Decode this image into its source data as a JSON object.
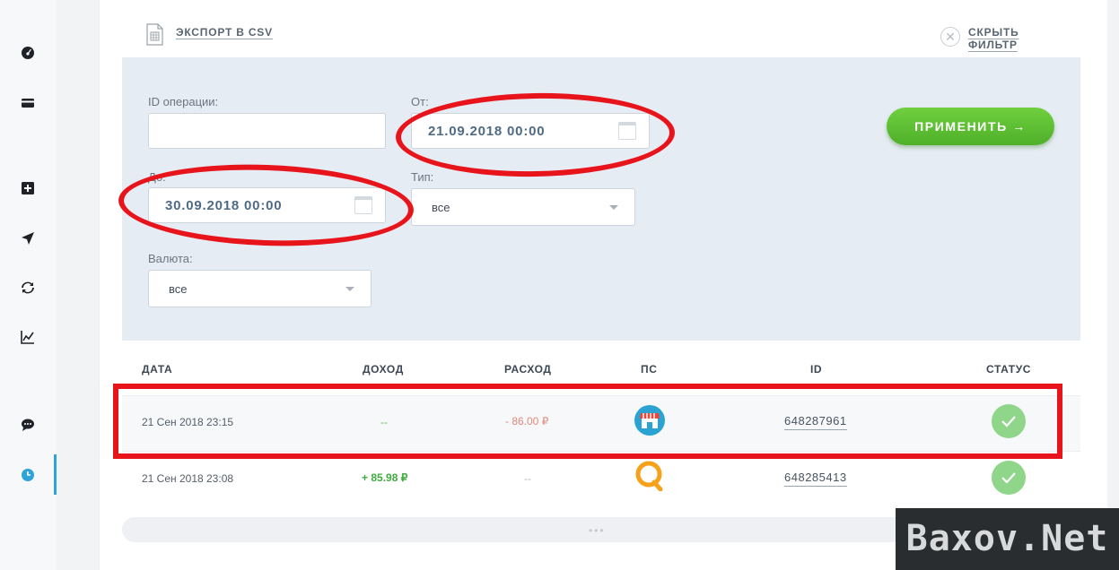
{
  "toolbar": {
    "export_label": "ЭКСПОРТ В CSV",
    "hide_filter_label": "СКРЫТЬ ФИЛЬТР"
  },
  "filter": {
    "op_id_label": "ID операции:",
    "op_id_value": "",
    "from_label": "От:",
    "from_value": "21.09.2018 00:00",
    "to_label": "До:",
    "to_value": "30.09.2018 00:00",
    "type_label": "Тип:",
    "type_value": "все",
    "currency_label": "Валюта:",
    "currency_value": "все",
    "apply_label": "ПРИМЕНИТЬ →"
  },
  "table": {
    "headers": [
      "ДАТА",
      "ДОХОД",
      "РАСХОД",
      "ПС",
      "ID",
      "СТАТУС"
    ],
    "rows": [
      {
        "date": "21 Сен 2018 23:15",
        "income": "--",
        "expense": "- 86.00 ₽",
        "ps": "shop-icon",
        "id": "648287961",
        "status": "check-icon"
      },
      {
        "date": "21 Сен 2018 23:08",
        "income": "+ 85.98 ₽",
        "expense": "--",
        "ps": "qiwi-icon",
        "id": "648285413",
        "status": "check-icon"
      }
    ],
    "more": "•••"
  },
  "watermark": "Baxov.Net",
  "colors": {
    "accent_green": "#4fb02a",
    "annotation_red": "#e8141b",
    "status_green": "#8fd58a",
    "filter_bg": "#e5ecf3"
  }
}
